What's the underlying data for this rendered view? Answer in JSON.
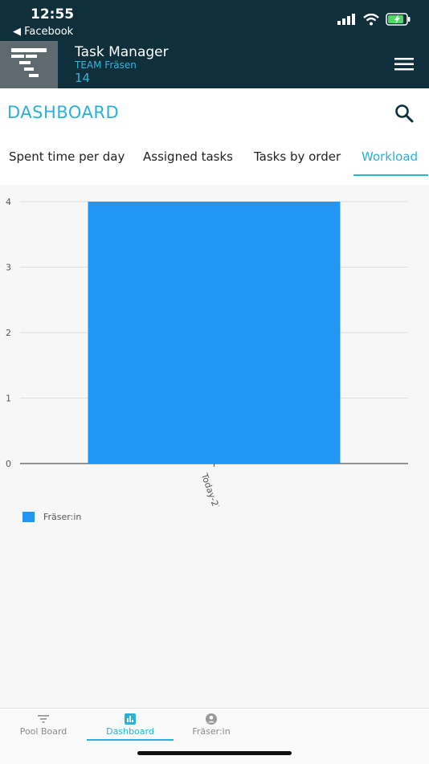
{
  "status_bar": {
    "time": "12:55",
    "back_app": "◀ Facebook"
  },
  "app_header": {
    "title": "Task Manager",
    "team": "TEAM Fräsen",
    "count": "14"
  },
  "page": {
    "title": "DASHBOARD"
  },
  "tabs": [
    {
      "label": "Spent time per day",
      "active": false
    },
    {
      "label": "Assigned tasks",
      "active": false
    },
    {
      "label": "Tasks by order",
      "active": false
    },
    {
      "label": "Workload",
      "active": true
    }
  ],
  "chart_data": {
    "type": "bar",
    "categories": [
      "Today-22"
    ],
    "series": [
      {
        "name": "Fräser:in",
        "values": [
          4
        ],
        "color": "#2196f3"
      }
    ],
    "ylim": [
      0,
      4
    ],
    "yticks": [
      0,
      1,
      2,
      3,
      4
    ],
    "grid": true,
    "legend_position": "bottom-left"
  },
  "bottom_nav": [
    {
      "label": "Pool Board",
      "icon": "filter-icon",
      "active": false
    },
    {
      "label": "Dashboard",
      "icon": "bar-chart-icon",
      "active": true
    },
    {
      "label": "Fräser:in",
      "icon": "account-circle-icon",
      "active": false
    }
  ],
  "colors": {
    "header_bg": "#0f2f3b",
    "accent": "#2ab0d9",
    "bar": "#2196f3"
  }
}
